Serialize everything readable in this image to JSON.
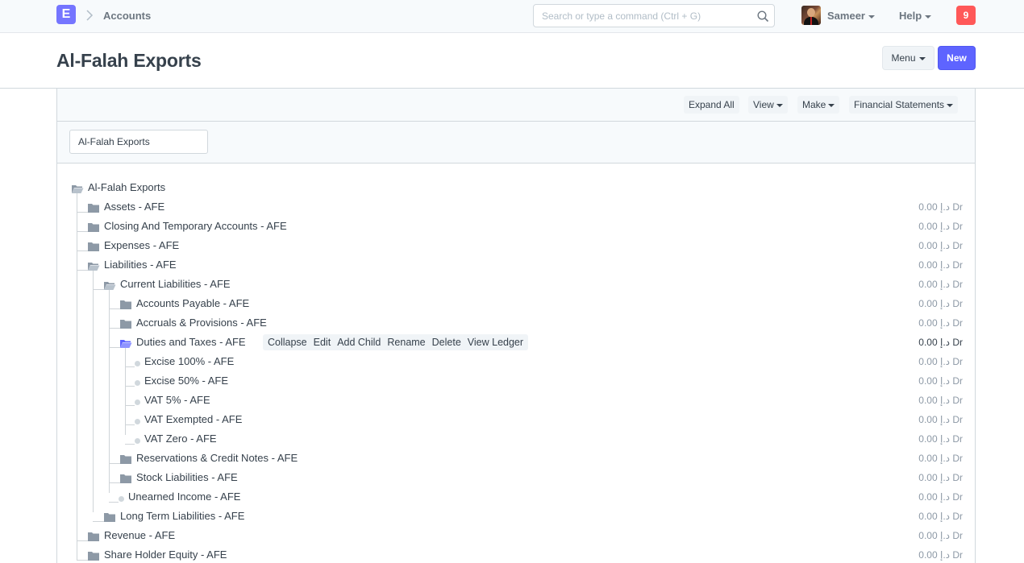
{
  "navbar": {
    "logo_letter": "E",
    "breadcrumb": "Accounts",
    "search_placeholder": "Search or type a command (Ctrl + G)",
    "user_name": "Sameer",
    "help_label": "Help",
    "notification_count": "9"
  },
  "page": {
    "title": "Al-Falah Exports",
    "menu_label": "Menu",
    "new_label": "New"
  },
  "toolbar": {
    "expand_all": "Expand All",
    "view": "View",
    "make": "Make",
    "financial_statements": "Financial Statements"
  },
  "filter": {
    "company_value": "Al-Falah Exports"
  },
  "tree": {
    "root": "Al-Falah Exports",
    "nodes": [
      {
        "label": "Assets - AFE",
        "balance": "0.00 د.إ Dr"
      },
      {
        "label": "Closing And Temporary Accounts - AFE",
        "balance": "0.00 د.إ Dr"
      },
      {
        "label": "Expenses - AFE",
        "balance": "0.00 د.إ Dr"
      },
      {
        "label": "Liabilities - AFE",
        "balance": "0.00 د.إ Dr"
      },
      {
        "label": "Current Liabilities - AFE",
        "balance": "0.00 د.إ Dr"
      },
      {
        "label": "Accounts Payable - AFE",
        "balance": "0.00 د.إ Dr"
      },
      {
        "label": "Accruals & Provisions - AFE",
        "balance": "0.00 د.إ Dr"
      },
      {
        "label": "Duties and Taxes - AFE",
        "balance": "0.00 د.إ Dr"
      },
      {
        "label": "Excise 100% - AFE",
        "balance": "0.00 د.إ Dr"
      },
      {
        "label": "Excise 50% - AFE",
        "balance": "0.00 د.إ Dr"
      },
      {
        "label": "VAT 5% - AFE",
        "balance": "0.00 د.إ Dr"
      },
      {
        "label": "VAT Exempted - AFE",
        "balance": "0.00 د.إ Dr"
      },
      {
        "label": "VAT Zero - AFE",
        "balance": "0.00 د.إ Dr"
      },
      {
        "label": "Reservations & Credit Notes - AFE",
        "balance": "0.00 د.إ Dr"
      },
      {
        "label": "Stock Liabilities - AFE",
        "balance": "0.00 د.إ Dr"
      },
      {
        "label": "Unearned Income - AFE",
        "balance": "0.00 د.إ Dr"
      },
      {
        "label": "Long Term Liabilities - AFE",
        "balance": "0.00 د.إ Dr"
      },
      {
        "label": "Revenue - AFE",
        "balance": "0.00 د.إ Dr"
      },
      {
        "label": "Share Holder Equity - AFE",
        "balance": "0.00 د.إ Dr"
      }
    ],
    "row_actions": {
      "collapse": "Collapse",
      "edit": "Edit",
      "add_child": "Add Child",
      "rename": "Rename",
      "delete": "Delete",
      "view_ledger": "View Ledger"
    }
  },
  "icons": {
    "folder": "folder-icon",
    "folder_open": "folder-open-icon",
    "leaf": "leaf-dot-icon",
    "search": "search-icon"
  },
  "colors": {
    "brand": "#7575ff",
    "primary": "#5e64ff",
    "notification": "#ff5858",
    "folder": "#8d99a6",
    "active_folder": "#5e64ff"
  }
}
